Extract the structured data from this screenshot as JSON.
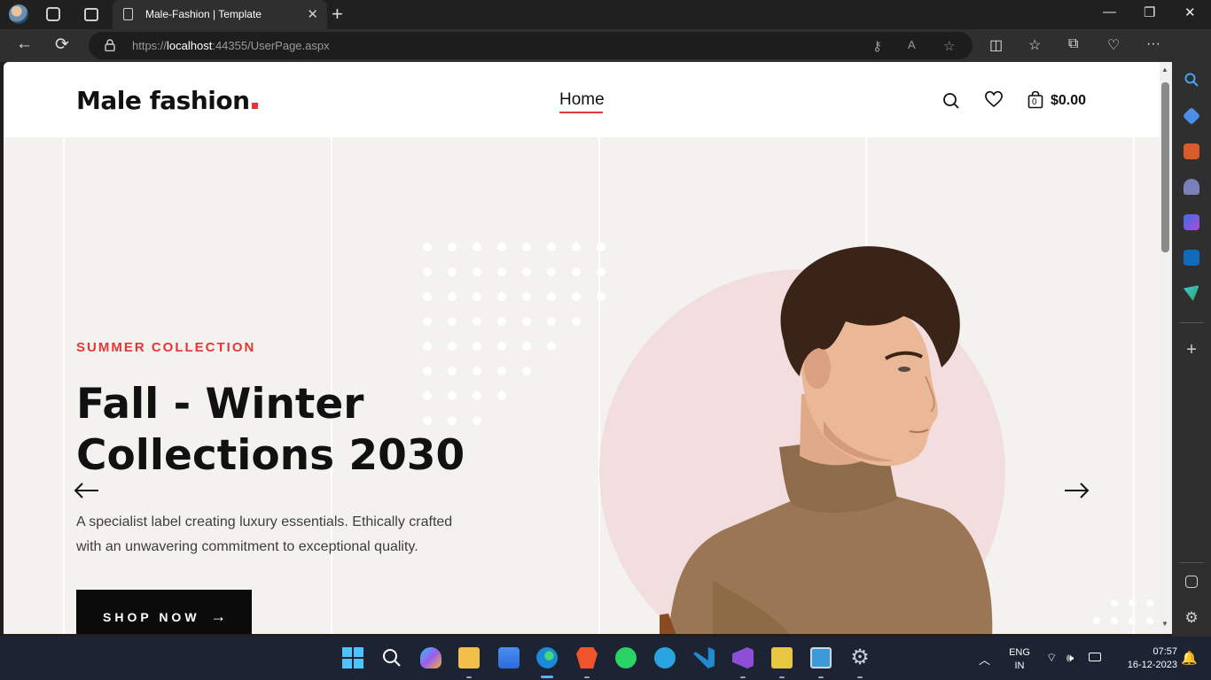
{
  "browser": {
    "tab_title": "Male-Fashion | Template",
    "url_prefix": "https://",
    "url_host": "localhost",
    "url_rest": ":44355/UserPage.aspx"
  },
  "site": {
    "logo_text": "Male fashion",
    "nav_home": "Home",
    "cart_total": "$0.00",
    "cart_count": "0"
  },
  "hero": {
    "subtitle": "SUMMER COLLECTION",
    "title_line1": "Fall - Winter",
    "title_line2": "Collections 2030",
    "description": "A specialist label creating luxury essentials. Ethically crafted with an unwavering commitment to exceptional quality.",
    "button_label": "SHOP NOW",
    "button_arrow": "→"
  },
  "taskbar": {
    "lang_line1": "ENG",
    "lang_line2": "IN",
    "time": "07:57",
    "date": "16-12-2023"
  },
  "colors": {
    "accent": "#e53637",
    "hero_bg": "#f3f2ee",
    "circle": "#f3dedf",
    "button_bg": "#0b0b0b"
  }
}
